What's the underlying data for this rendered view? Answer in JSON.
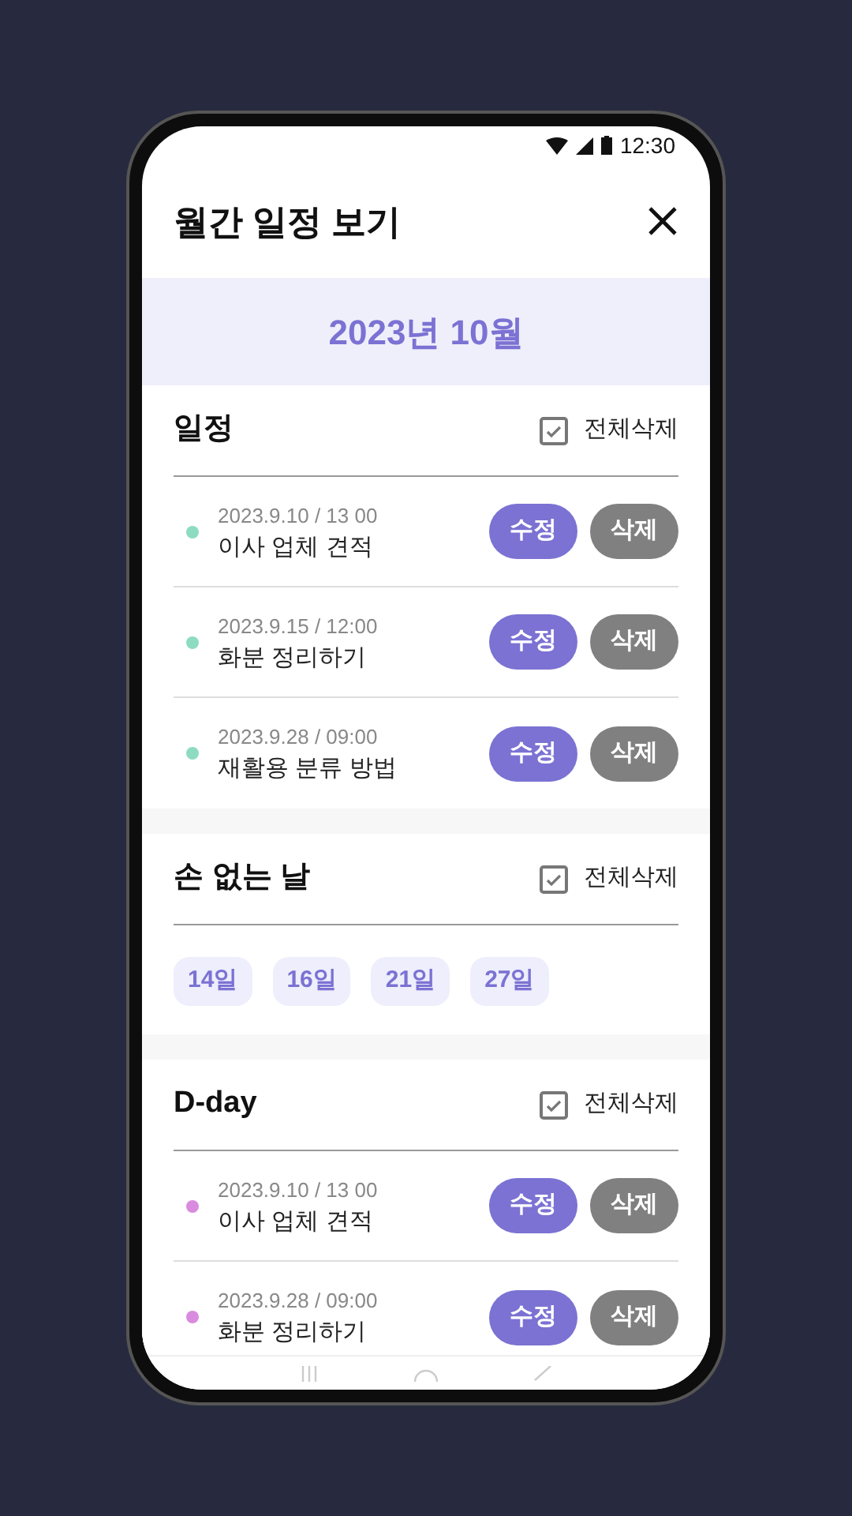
{
  "status_bar": {
    "time": "12:30"
  },
  "header": {
    "title": "월간 일정 보기"
  },
  "month": {
    "label": "2023년 10월"
  },
  "sections": [
    {
      "kind": "events",
      "title": "일정",
      "delete_all": {
        "label": "전체삭제",
        "checked": true
      },
      "items": [
        {
          "datetime": "2023.9.10 / 13 00",
          "title": "이사 업체 견적",
          "color": "#8ddcc2",
          "edit": "수정",
          "delete": "삭제"
        },
        {
          "datetime": "2023.9.15 / 12:00",
          "title": "화분 정리하기",
          "color": "#8ddcc2",
          "edit": "수정",
          "delete": "삭제"
        },
        {
          "datetime": "2023.9.28 / 09:00",
          "title": "재활용 분류 방법",
          "color": "#8ddcc2",
          "edit": "수정",
          "delete": "삭제"
        }
      ]
    },
    {
      "kind": "days",
      "title": "손 없는 날",
      "delete_all": {
        "label": "전체삭제",
        "checked": true
      },
      "days": [
        "14일",
        "16일",
        "21일",
        "27일"
      ]
    },
    {
      "kind": "events",
      "title": "D-day",
      "delete_all": {
        "label": "전체삭제",
        "checked": true
      },
      "items": [
        {
          "datetime": "2023.9.10 / 13 00",
          "title": "이사 업체 견적",
          "color": "#d98be0",
          "edit": "수정",
          "delete": "삭제"
        },
        {
          "datetime": "2023.9.28 / 09:00",
          "title": "화분 정리하기",
          "color": "#d98be0",
          "edit": "수정",
          "delete": "삭제"
        }
      ]
    }
  ]
}
